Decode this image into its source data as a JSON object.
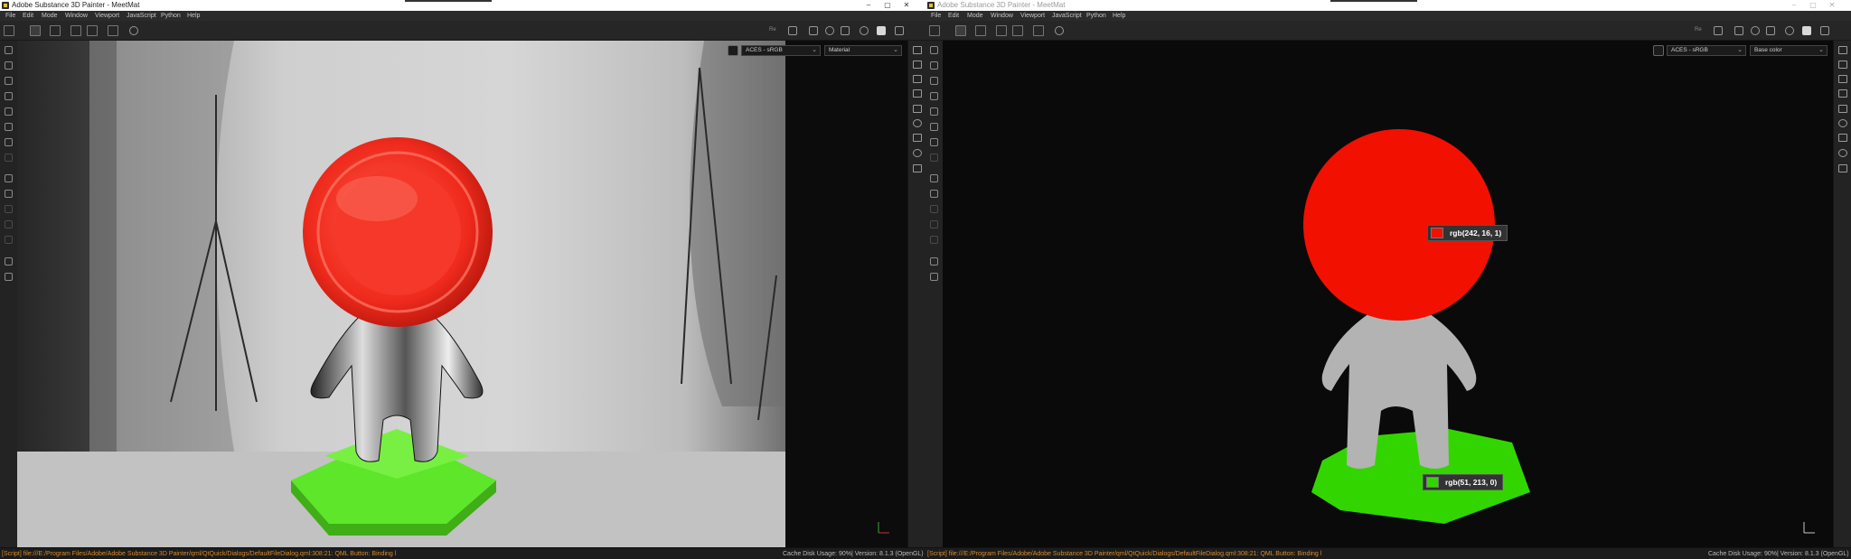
{
  "left": {
    "title": "Adobe Substance 3D Painter - MeetMat",
    "menu": [
      "File",
      "Edit",
      "Mode",
      "Window",
      "Viewport",
      "JavaScript",
      "Python",
      "Help"
    ],
    "toolbar_right_text": "Re",
    "colorspace": "ACES - sRGB",
    "channel": "Material",
    "status_script": "[Script] file:///E:/Program Files/Adobe/Adobe Substance 3D Painter/qml/QtQuick/Dialogs/DefaultFileDialog.qml:308:21: QML Button: Binding l",
    "cache": "Cache Disk Usage:",
    "cache_value": "90%",
    "version": "| Version: 8.1.3 (OpenGL)"
  },
  "right": {
    "title": "Adobe Substance 3D Painter - MeetMat",
    "menu": [
      "File",
      "Edit",
      "Mode",
      "Window",
      "Viewport",
      "JavaScript",
      "Python",
      "Help"
    ],
    "toolbar_right_text": "Re",
    "colorspace": "ACES - sRGB",
    "channel": "Base color",
    "status_script": "[Script] file:///E:/Program Files/Adobe/Adobe Substance 3D Painter/qml/QtQuick/Dialogs/DefaultFileDialog.qml:308:21: QML Button: Binding l",
    "cache": "Cache Disk Usage:",
    "cache_value": "90%",
    "version": "| Version: 8.1.3 (OpenGL)",
    "picker_head": "rgb(242, 16, 1)",
    "picker_base": "rgb(51, 213, 0)",
    "picker_head_color": "#f21001",
    "picker_base_color": "#33d500"
  },
  "icons": {
    "window_controls": [
      "minimize-icon",
      "maximize-icon",
      "close-icon"
    ],
    "viewport_left": [
      "color-picker-icon"
    ],
    "viewport_right": [
      "color-picker-icon"
    ]
  }
}
